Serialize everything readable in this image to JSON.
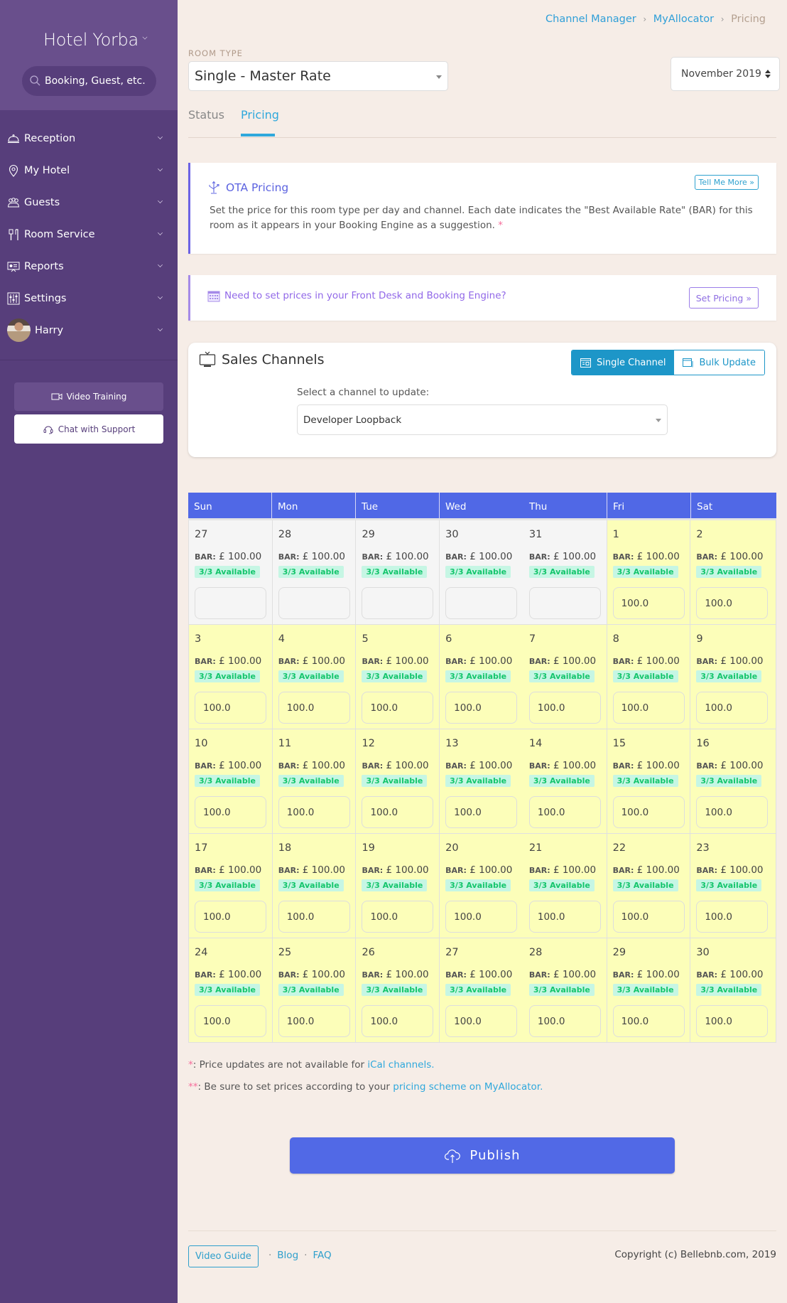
{
  "sidebar": {
    "hotel_name": "Hotel Yorba",
    "search_placeholder": "Booking, Guest, etc.",
    "nav": [
      {
        "label": "Reception",
        "icon": "bell-icon"
      },
      {
        "label": "My Hotel",
        "icon": "map-pin-icon"
      },
      {
        "label": "Guests",
        "icon": "users-icon"
      },
      {
        "label": "Room Service",
        "icon": "utensils-icon"
      },
      {
        "label": "Reports",
        "icon": "presentation-icon"
      },
      {
        "label": "Settings",
        "icon": "sliders-icon"
      }
    ],
    "user": {
      "name": "Harry"
    },
    "video_training_label": "Video Training",
    "chat_support_label": "Chat with Support"
  },
  "breadcrumb": {
    "items": [
      "Channel Manager",
      "MyAllocator"
    ],
    "current": "Pricing",
    "separator": "›"
  },
  "room_type": {
    "label": "ROOM TYPE",
    "selected": "Single - Master Rate"
  },
  "month_select": {
    "selected": "November 2019"
  },
  "tabs": [
    {
      "label": "Status",
      "active": false
    },
    {
      "label": "Pricing",
      "active": true
    }
  ],
  "ota_card": {
    "title": "OTA Pricing",
    "text": "Set the price for this room type per day and channel. Each date indicates the \"Best Available Rate\" (BAR) for this room as it appears in your Booking Engine as a suggestion.",
    "asterisk": "*",
    "button": "Tell Me More »"
  },
  "front_desk_card": {
    "text": "Need to set prices in your Front Desk and Booking Engine?",
    "button": "Set Pricing »"
  },
  "sales_channels": {
    "title": "Sales Channels",
    "single_channel_label": "Single Channel",
    "bulk_update_label": "Bulk Update",
    "select_label": "Select a channel to update:",
    "selected_channel": "Developer Loopback"
  },
  "calendar": {
    "weekdays": [
      "Sun",
      "Mon",
      "Tue",
      "Wed",
      "Thu",
      "Fri",
      "Sat"
    ],
    "bar_label": "BAR:",
    "currency": "£",
    "weeks": [
      [
        {
          "day": "27",
          "bar": "100.00",
          "avail": "3/3 Available",
          "price": "",
          "past": true
        },
        {
          "day": "28",
          "bar": "100.00",
          "avail": "3/3 Available",
          "price": "",
          "past": true
        },
        {
          "day": "29",
          "bar": "100.00",
          "avail": "3/3 Available",
          "price": "",
          "past": true
        },
        {
          "day": "30",
          "bar": "100.00",
          "avail": "3/3 Available",
          "price": "",
          "past": true
        },
        {
          "day": "31",
          "bar": "100.00",
          "avail": "3/3 Available",
          "price": "",
          "past": true
        },
        {
          "day": "1",
          "bar": "100.00",
          "avail": "3/3 Available",
          "price": "100.0",
          "past": false
        },
        {
          "day": "2",
          "bar": "100.00",
          "avail": "3/3 Available",
          "price": "100.0",
          "past": false
        }
      ],
      [
        {
          "day": "3",
          "bar": "100.00",
          "avail": "3/3 Available",
          "price": "100.0",
          "past": false
        },
        {
          "day": "4",
          "bar": "100.00",
          "avail": "3/3 Available",
          "price": "100.0",
          "past": false
        },
        {
          "day": "5",
          "bar": "100.00",
          "avail": "3/3 Available",
          "price": "100.0",
          "past": false
        },
        {
          "day": "6",
          "bar": "100.00",
          "avail": "3/3 Available",
          "price": "100.0",
          "past": false
        },
        {
          "day": "7",
          "bar": "100.00",
          "avail": "3/3 Available",
          "price": "100.0",
          "past": false
        },
        {
          "day": "8",
          "bar": "100.00",
          "avail": "3/3 Available",
          "price": "100.0",
          "past": false
        },
        {
          "day": "9",
          "bar": "100.00",
          "avail": "3/3 Available",
          "price": "100.0",
          "past": false
        }
      ],
      [
        {
          "day": "10",
          "bar": "100.00",
          "avail": "3/3 Available",
          "price": "100.0",
          "past": false
        },
        {
          "day": "11",
          "bar": "100.00",
          "avail": "3/3 Available",
          "price": "100.0",
          "past": false
        },
        {
          "day": "12",
          "bar": "100.00",
          "avail": "3/3 Available",
          "price": "100.0",
          "past": false
        },
        {
          "day": "13",
          "bar": "100.00",
          "avail": "3/3 Available",
          "price": "100.0",
          "past": false
        },
        {
          "day": "14",
          "bar": "100.00",
          "avail": "3/3 Available",
          "price": "100.0",
          "past": false
        },
        {
          "day": "15",
          "bar": "100.00",
          "avail": "3/3 Available",
          "price": "100.0",
          "past": false
        },
        {
          "day": "16",
          "bar": "100.00",
          "avail": "3/3 Available",
          "price": "100.0",
          "past": false
        }
      ],
      [
        {
          "day": "17",
          "bar": "100.00",
          "avail": "3/3 Available",
          "price": "100.0",
          "past": false
        },
        {
          "day": "18",
          "bar": "100.00",
          "avail": "3/3 Available",
          "price": "100.0",
          "past": false
        },
        {
          "day": "19",
          "bar": "100.00",
          "avail": "3/3 Available",
          "price": "100.0",
          "past": false
        },
        {
          "day": "20",
          "bar": "100.00",
          "avail": "3/3 Available",
          "price": "100.0",
          "past": false
        },
        {
          "day": "21",
          "bar": "100.00",
          "avail": "3/3 Available",
          "price": "100.0",
          "past": false
        },
        {
          "day": "22",
          "bar": "100.00",
          "avail": "3/3 Available",
          "price": "100.0",
          "past": false
        },
        {
          "day": "23",
          "bar": "100.00",
          "avail": "3/3 Available",
          "price": "100.0",
          "past": false
        }
      ],
      [
        {
          "day": "24",
          "bar": "100.00",
          "avail": "3/3 Available",
          "price": "100.0",
          "past": false
        },
        {
          "day": "25",
          "bar": "100.00",
          "avail": "3/3 Available",
          "price": "100.0",
          "past": false
        },
        {
          "day": "26",
          "bar": "100.00",
          "avail": "3/3 Available",
          "price": "100.0",
          "past": false
        },
        {
          "day": "27",
          "bar": "100.00",
          "avail": "3/3 Available",
          "price": "100.0",
          "past": false
        },
        {
          "day": "28",
          "bar": "100.00",
          "avail": "3/3 Available",
          "price": "100.0",
          "past": false
        },
        {
          "day": "29",
          "bar": "100.00",
          "avail": "3/3 Available",
          "price": "100.0",
          "past": false
        },
        {
          "day": "30",
          "bar": "100.00",
          "avail": "3/3 Available",
          "price": "100.0",
          "past": false
        }
      ]
    ]
  },
  "notes": {
    "note1_marker": "*",
    "note1_text": ": Price updates are not available for ",
    "note1_link": "iCal channels.",
    "note2_marker": "**",
    "note2_text": ": Be sure to set prices according to your ",
    "note2_link": "pricing scheme on MyAllocator."
  },
  "publish_label": "Publish",
  "footer": {
    "video_guide": "Video Guide",
    "links": [
      "Blog",
      "FAQ"
    ],
    "separator": "·",
    "copyright": "Copyright (c) Bellebnb.com, 2019"
  },
  "colors": {
    "sidebar_bg": "#573e7b",
    "sidebar_header_bg": "#694f8c",
    "page_bg": "#f6ede7",
    "accent_blue": "#5169e6",
    "link_blue": "#2fa8dc",
    "available_cell": "#fcfeb9",
    "past_cell": "#f5f5f5",
    "available_badge_bg": "#c6f6e4",
    "available_badge_text": "#14c56c"
  }
}
